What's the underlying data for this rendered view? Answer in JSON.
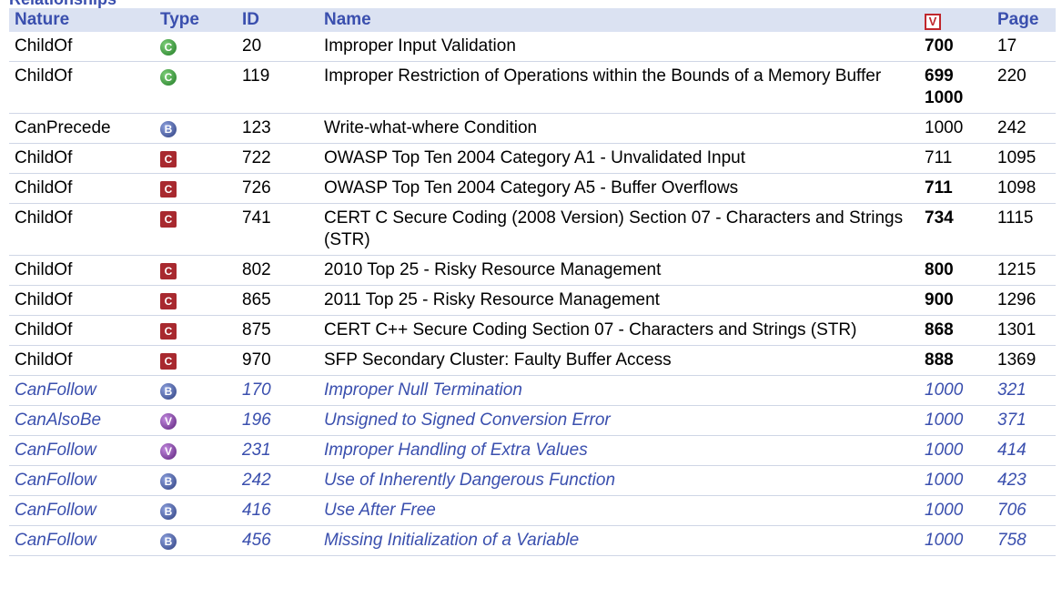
{
  "heading": "Relationships",
  "columns": {
    "nature": "Nature",
    "type": "Type",
    "id": "ID",
    "name": "Name",
    "view_marker": "V",
    "page": "Page"
  },
  "rows": [
    {
      "nature": "ChildOf",
      "type": "class",
      "glyph": "C",
      "id": "20",
      "name": "Improper Input Validation",
      "views": [
        "700"
      ],
      "views_bold": true,
      "page": "17",
      "style": "std"
    },
    {
      "nature": "ChildOf",
      "type": "class",
      "glyph": "C",
      "id": "119",
      "name": "Improper Restriction of Operations within the Bounds of a Memory Buffer",
      "views": [
        "699",
        "1000"
      ],
      "views_bold": true,
      "page": "220",
      "style": "std"
    },
    {
      "nature": "CanPrecede",
      "type": "base",
      "glyph": "B",
      "id": "123",
      "name": "Write-what-where Condition",
      "views": [
        "1000"
      ],
      "views_bold": false,
      "page": "242",
      "style": "std"
    },
    {
      "nature": "ChildOf",
      "type": "category",
      "glyph": "C",
      "id": "722",
      "name": "OWASP Top Ten 2004 Category A1 - Unvalidated Input",
      "views": [
        "711"
      ],
      "views_bold": false,
      "page": "1095",
      "style": "std"
    },
    {
      "nature": "ChildOf",
      "type": "category",
      "glyph": "C",
      "id": "726",
      "name": "OWASP Top Ten 2004 Category A5 - Buffer Overflows",
      "views": [
        "711"
      ],
      "views_bold": true,
      "page": "1098",
      "style": "std"
    },
    {
      "nature": "ChildOf",
      "type": "category",
      "glyph": "C",
      "id": "741",
      "name": "CERT C Secure Coding (2008 Version) Section 07 - Characters and Strings (STR)",
      "views": [
        "734"
      ],
      "views_bold": true,
      "page": "1115",
      "style": "std"
    },
    {
      "nature": "ChildOf",
      "type": "category",
      "glyph": "C",
      "id": "802",
      "name": "2010 Top 25 - Risky Resource Management",
      "views": [
        "800"
      ],
      "views_bold": true,
      "page": "1215",
      "style": "std"
    },
    {
      "nature": "ChildOf",
      "type": "category",
      "glyph": "C",
      "id": "865",
      "name": "2011 Top 25 - Risky Resource Management",
      "views": [
        "900"
      ],
      "views_bold": true,
      "page": "1296",
      "style": "std"
    },
    {
      "nature": "ChildOf",
      "type": "category",
      "glyph": "C",
      "id": "875",
      "name": "CERT C++ Secure Coding Section 07 - Characters and Strings (STR)",
      "views": [
        "868"
      ],
      "views_bold": true,
      "page": "1301",
      "style": "std"
    },
    {
      "nature": "ChildOf",
      "type": "category",
      "glyph": "C",
      "id": "970",
      "name": "SFP Secondary Cluster: Faulty Buffer Access",
      "views": [
        "888"
      ],
      "views_bold": true,
      "page": "1369",
      "style": "std"
    },
    {
      "nature": "CanFollow",
      "type": "base",
      "glyph": "B",
      "id": "170",
      "name": "Improper Null Termination",
      "views": [
        "1000"
      ],
      "views_bold": false,
      "page": "321",
      "style": "alt"
    },
    {
      "nature": "CanAlsoBe",
      "type": "variant",
      "glyph": "V",
      "id": "196",
      "name": "Unsigned to Signed Conversion Error",
      "views": [
        "1000"
      ],
      "views_bold": false,
      "page": "371",
      "style": "alt"
    },
    {
      "nature": "CanFollow",
      "type": "variant",
      "glyph": "V",
      "id": "231",
      "name": "Improper Handling of Extra Values",
      "views": [
        "1000"
      ],
      "views_bold": false,
      "page": "414",
      "style": "alt"
    },
    {
      "nature": "CanFollow",
      "type": "base",
      "glyph": "B",
      "id": "242",
      "name": "Use of Inherently Dangerous Function",
      "views": [
        "1000"
      ],
      "views_bold": false,
      "page": "423",
      "style": "alt"
    },
    {
      "nature": "CanFollow",
      "type": "base",
      "glyph": "B",
      "id": "416",
      "name": "Use After Free",
      "views": [
        "1000"
      ],
      "views_bold": false,
      "page": "706",
      "style": "alt"
    },
    {
      "nature": "CanFollow",
      "type": "base",
      "glyph": "B",
      "id": "456",
      "name": "Missing Initialization of a Variable",
      "views": [
        "1000"
      ],
      "views_bold": false,
      "page": "758",
      "style": "alt"
    }
  ],
  "colors": {
    "header_text": "#3a4fae",
    "header_bg": "#dbe2f2",
    "view_marker": "#c0272d"
  }
}
